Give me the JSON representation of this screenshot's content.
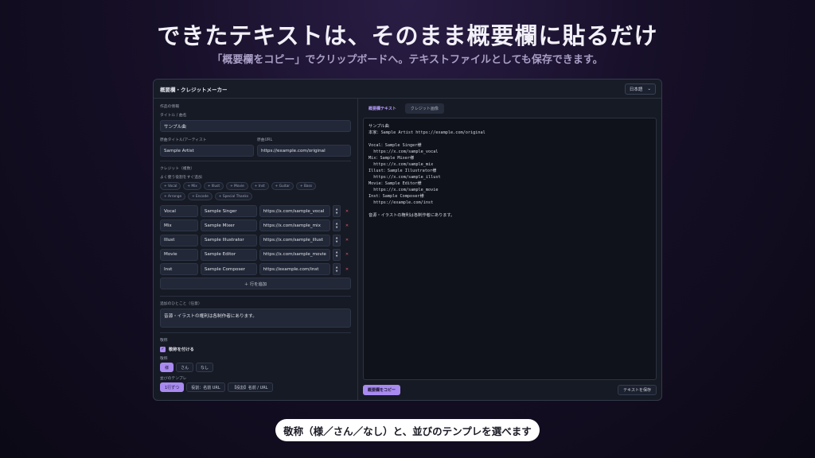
{
  "hero": {
    "title": "できたテキストは、そのまま概要欄に貼るだけ",
    "subtitle": "「概要欄をコピー」でクリップボードへ。テキストファイルとしても保存できます。"
  },
  "app": {
    "title": "概要欄・クレジットメーカー",
    "language": "日本語",
    "work_info_label": "作品の情報",
    "title_field_label": "タイトル / 曲名",
    "title_value": "サンプル曲",
    "original_title_label": "原曲タイトル/アーティスト",
    "original_title_value": "Sample Artist",
    "original_url_label": "原曲URL",
    "original_url_value": "https://example.com/original",
    "credits_label": "クレジット（複数）",
    "quick_add_label": "よく使う役割をすぐ追加",
    "chips": [
      "+ Vocal",
      "+ Mix",
      "+ Illust",
      "+ Movie",
      "+ Inst",
      "+ Guitar",
      "+ Bass",
      "+ Arrange",
      "+ Encode",
      "+ Special Thanks"
    ],
    "credits": [
      {
        "role": "Vocal",
        "name": "Sample Singer",
        "url": "https://x.com/sample_vocal"
      },
      {
        "role": "Mix",
        "name": "Sample Mixer",
        "url": "https://x.com/sample_mix"
      },
      {
        "role": "Illust",
        "name": "Sample Illustrator",
        "url": "https://x.com/sample_illust"
      },
      {
        "role": "Movie",
        "name": "Sample Editor",
        "url": "https://x.com/sample_movie"
      },
      {
        "role": "Inst",
        "name": "Sample Composer",
        "url": "https://example.com/inst"
      }
    ],
    "add_row_label": "＋ 行を追加",
    "note_label": "追加のひとこと（任意）",
    "note_value": "音源・イラストの権利は各制作者にあります。",
    "honorific_section_label": "敬称",
    "honorific_checkbox_label": "敬称を付ける",
    "honorific_label": "敬称",
    "honorific_options": [
      "様",
      "さん",
      "なし"
    ],
    "template_label": "並びのテンプレ",
    "template_options": [
      "1行ずつ",
      "役割：名前 URL",
      "【役割】名前 / URL"
    ],
    "tabs": [
      "概要欄テキスト",
      "クレジット画像"
    ],
    "preview_text": "サンプル曲\n本家：Sample Artist https://example.com/original\n\nVocal：Sample Singer様\n  https://x.com/sample_vocal\nMix：Sample Mixer様\n  https://x.com/sample_mix\nIllust：Sample Illustrator様\n  https://x.com/sample_illust\nMovie：Sample Editor様\n  https://x.com/sample_movie\nInst：Sample Composer様\n  https://example.com/inst\n\n音源・イラストの権利は各制作者にあります。",
    "copy_button": "概要欄をコピー",
    "save_button": "テキストを保存"
  },
  "caption": "敬称（様／さん／なし）と、並びのテンプレを選べます",
  "colors": {
    "accent": "#a88af0",
    "delete": "#e0566a"
  }
}
